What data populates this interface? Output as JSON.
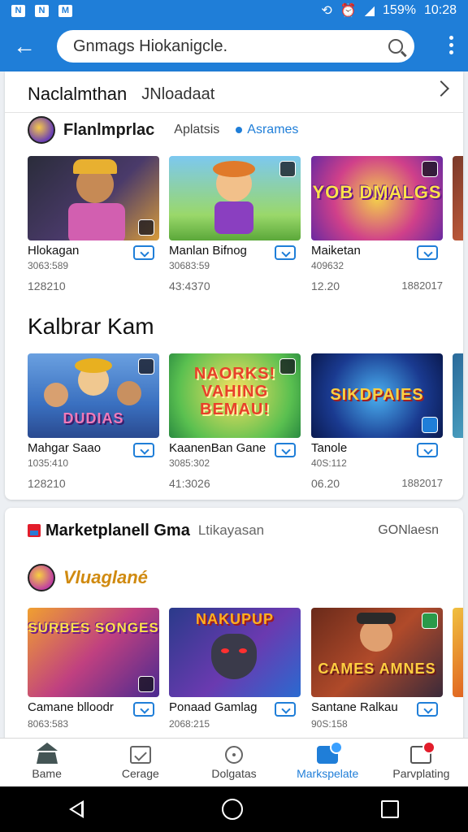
{
  "status_bar": {
    "left_icons": [
      "N",
      "N",
      "M"
    ],
    "battery": "159%",
    "time": "10:28"
  },
  "search": {
    "value": "Gnmags Hiokanigcle.",
    "placeholder": ""
  },
  "section1": {
    "header_title": "Naclalmthan",
    "header_subtitle": "JNloadaat",
    "developer": {
      "name": "Flanlmprlac",
      "apps_label": "Aplatsis",
      "games_label": "Asrames"
    },
    "tiles": [
      {
        "name": "Hlokagan",
        "meta1": "3063:589",
        "meta2": "128210",
        "meta2_right": ""
      },
      {
        "name": "Manlan Bifnog",
        "meta1": "30683:59",
        "meta2": "43:4370",
        "meta2_right": ""
      },
      {
        "name": "Maiketan",
        "meta1": "409632",
        "meta2": "12.20",
        "meta2_right": "1882017"
      }
    ],
    "thumb_text": [
      "",
      "",
      "YOB DMALGS"
    ]
  },
  "section2": {
    "title": "Kalbrar Kam",
    "tiles": [
      {
        "name": "Mahgar Saao",
        "meta1": "1035:410",
        "meta2": "128210",
        "meta2_right": ""
      },
      {
        "name": "KaanenBan Gane",
        "meta1": "3085:302",
        "meta2": "41:3026",
        "meta2_right": ""
      },
      {
        "name": "Tanole",
        "meta1": "40S:112",
        "meta2": "06.20",
        "meta2_right": "1882017"
      }
    ],
    "thumb_text": [
      "DUDIAS",
      "NAORKS! VAHING BEMAU!",
      "SIKDPAIES"
    ]
  },
  "section3": {
    "title": "Marketplanell Gma",
    "subtitle": "Ltikayasan",
    "right_label": "GONlaesn",
    "developer_name": "Vluaglané",
    "tiles": [
      {
        "name": "Camane blloodr",
        "meta1": "8063:583"
      },
      {
        "name": "Ponaad Gamlag",
        "meta1": "2068:215"
      },
      {
        "name": "Santane Ralkau",
        "meta1": "90S:158"
      }
    ],
    "thumb_text": [
      "SURBES SONGES",
      "NAKUPUP",
      "CAMES AMNES"
    ]
  },
  "bottom_nav": [
    {
      "label": "Bame",
      "icon": "home-icon"
    },
    {
      "label": "Cerage",
      "icon": "category-icon"
    },
    {
      "label": "Dolgatas",
      "icon": "circle-icon"
    },
    {
      "label": "Markspelate",
      "icon": "marketplace-icon"
    },
    {
      "label": "Parvplating",
      "icon": "payment-icon"
    }
  ],
  "colors": {
    "primary": "#1f7ed8",
    "active_nav": "#1f7ed8",
    "notification": "#e21d2b"
  }
}
